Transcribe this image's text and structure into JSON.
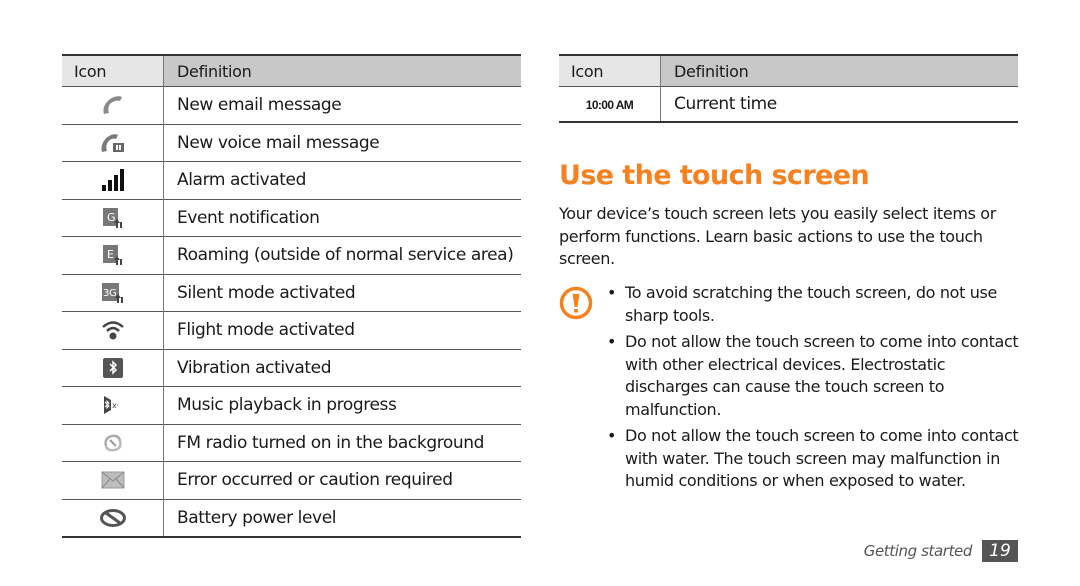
{
  "left_table": {
    "headers": {
      "icon": "Icon",
      "definition": "Definition"
    },
    "rows": [
      {
        "icon": "phone-handset-icon",
        "definition": "New email message"
      },
      {
        "icon": "phone-voicemail-icon",
        "definition": "New voice mail message"
      },
      {
        "icon": "signal-strength-icon",
        "definition": "Alarm activated"
      },
      {
        "icon": "gprs-network-icon",
        "definition": "Event notification"
      },
      {
        "icon": "edge-network-icon",
        "definition": "Roaming (outside of normal service area)"
      },
      {
        "icon": "3g-network-icon",
        "definition": "Silent mode activated"
      },
      {
        "icon": "wifi-icon",
        "definition": "Flight mode activated"
      },
      {
        "icon": "bluetooth-icon",
        "definition": "Vibration activated"
      },
      {
        "icon": "bluetooth-headset-icon",
        "definition": "Music playback in progress"
      },
      {
        "icon": "sync-icon",
        "definition": "FM radio turned on in the background"
      },
      {
        "icon": "envelope-icon",
        "definition": "Error occurred or caution required"
      },
      {
        "icon": "no-sim-icon",
        "definition": "Battery power level"
      }
    ]
  },
  "right_table": {
    "headers": {
      "icon": "Icon",
      "definition": "Definition"
    },
    "rows": [
      {
        "icon_text": "10:00 AM",
        "definition": "Current time"
      }
    ]
  },
  "section": {
    "title": "Use the touch screen",
    "intro": "Your device’s touch screen lets you easily select items or perform functions. Learn basic actions to use the touch screen.",
    "caution_icon": "caution-icon",
    "bullet_glyph": "•",
    "bullets": [
      "To avoid scratching the touch screen, do not use sharp tools.",
      "Do not allow the touch screen to come into contact with other electrical devices. Electrostatic discharges can cause the touch screen to malfunction.",
      "Do not allow the touch screen to come into contact with water. The touch screen may malfunction in humid conditions or when exposed to water."
    ]
  },
  "footer": {
    "section_name": "Getting started",
    "page_number": "19"
  },
  "colors": {
    "accent": "#f58220",
    "header_light": "#e6e6e6",
    "header_dark": "#c8c8c8",
    "page_badge": "#555555"
  }
}
